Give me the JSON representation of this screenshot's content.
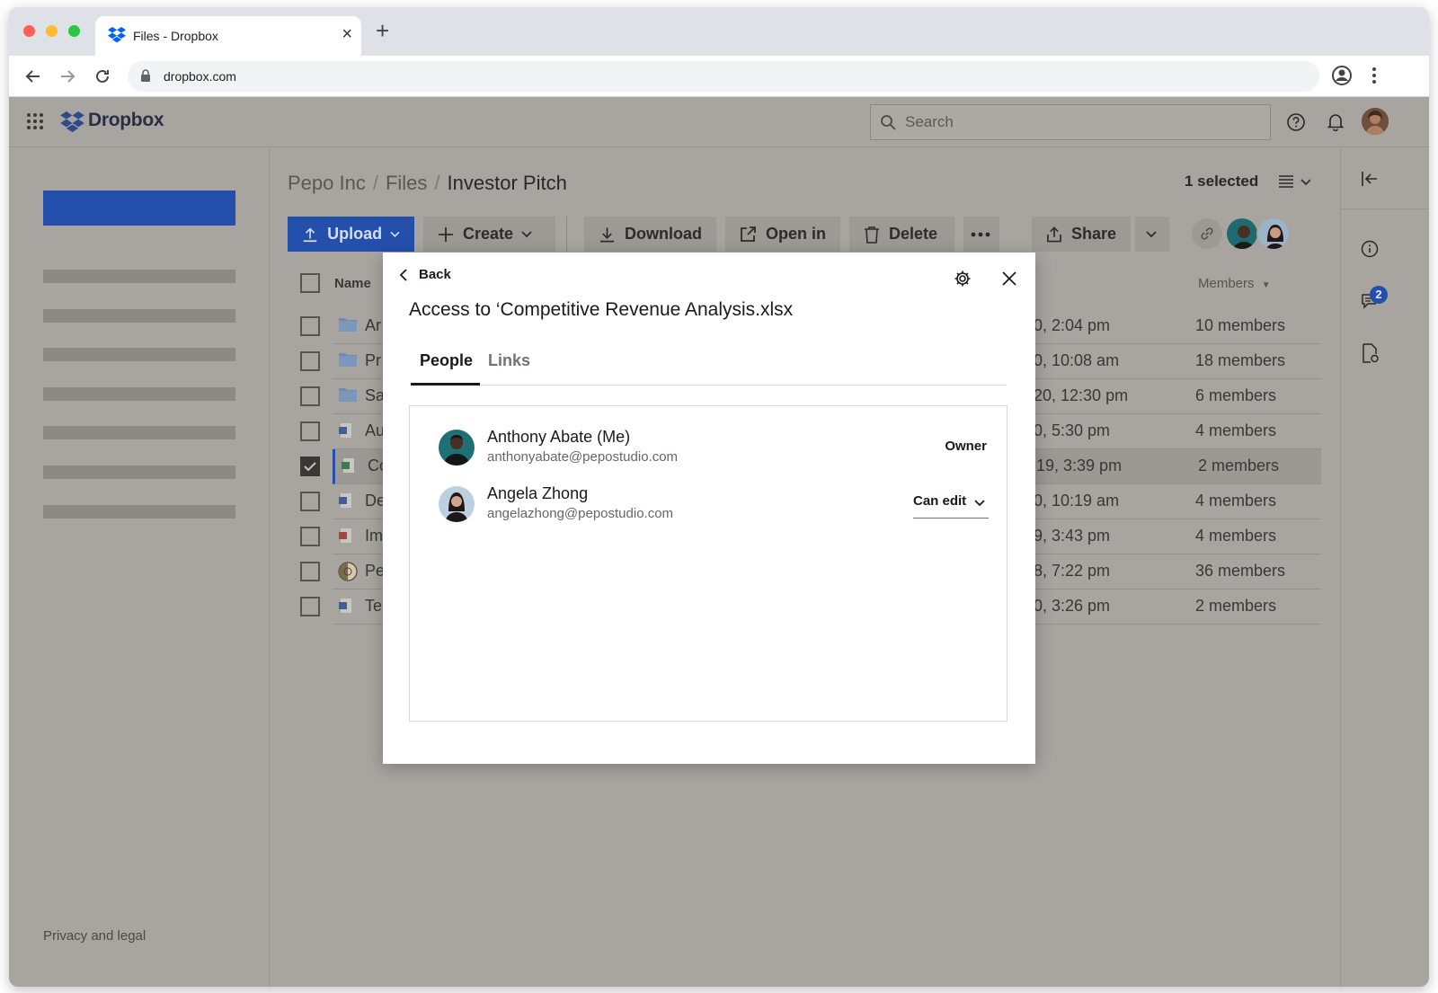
{
  "browser": {
    "tab_title": "Files - Dropbox",
    "url": "dropbox.com",
    "colors": {
      "close": "#ff5f57",
      "minimize": "#febc2e",
      "maximize": "#28c840"
    }
  },
  "app": {
    "logo": "Dropbox",
    "search_placeholder": "Search",
    "privacy": "Privacy and legal"
  },
  "breadcrumb": {
    "root": "Pepo Inc",
    "middle": "Files",
    "current": "Investor Pitch"
  },
  "selection": {
    "count_label": "1 selected"
  },
  "actions": {
    "upload": "Upload",
    "create": "Create",
    "download": "Download",
    "open_in": "Open in",
    "delete": "Delete",
    "share": "Share"
  },
  "table": {
    "col_name": "Name",
    "col_members": "Members",
    "rows": [
      {
        "name": "Ar",
        "icon": "folder-icon",
        "date": "0, 2:04 pm",
        "members": "10 members",
        "checked": false
      },
      {
        "name": "Pr",
        "icon": "folder-icon",
        "date": "0, 10:08 am",
        "members": "18 members",
        "checked": false
      },
      {
        "name": "Sa",
        "icon": "folder-icon",
        "date": "20, 12:30 pm",
        "members": "6 members",
        "checked": false
      },
      {
        "name": "Au",
        "icon": "word-file-icon",
        "date": "0, 5:30 pm",
        "members": "4 members",
        "checked": false
      },
      {
        "name": "Co",
        "icon": "excel-file-icon",
        "date": "19, 3:39 pm",
        "members": "2 members",
        "checked": true
      },
      {
        "name": "De",
        "icon": "word-file-icon",
        "date": "0, 10:19 am",
        "members": "4 members",
        "checked": false
      },
      {
        "name": "Im",
        "icon": "pdf-file-icon",
        "date": "9, 3:43 pm",
        "members": "4 members",
        "checked": false
      },
      {
        "name": "Pe",
        "icon": "image-file-icon",
        "date": "8, 7:22 pm",
        "members": "36 members",
        "checked": false
      },
      {
        "name": "Te",
        "icon": "word-file-icon",
        "date": "0, 3:26 pm",
        "members": "2 members",
        "checked": false
      }
    ]
  },
  "rail": {
    "comment_badge": "2"
  },
  "modal": {
    "back": "Back",
    "title": "Access to ‘Competitive Revenue Analysis.xlsx",
    "tab_people": "People",
    "tab_links": "Links",
    "people": [
      {
        "name": "Anthony Abate (Me)",
        "email": "anthonyabate@pepostudio.com",
        "role": "Owner"
      },
      {
        "name": "Angela Zhong",
        "email": "angelazhong@pepostudio.com",
        "role": "Can edit"
      }
    ]
  }
}
